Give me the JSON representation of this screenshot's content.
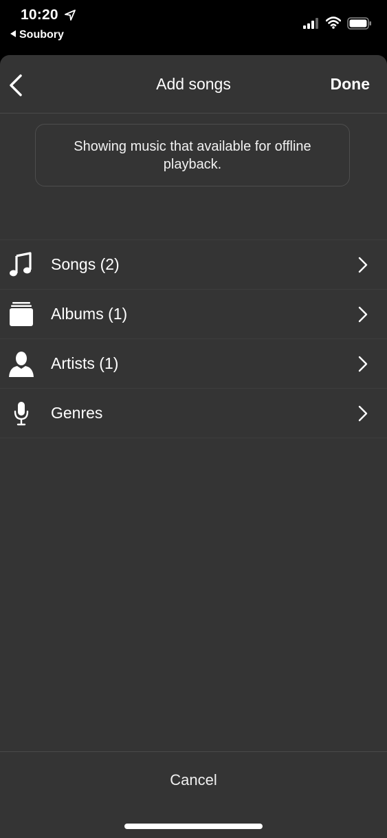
{
  "status_bar": {
    "time": "10:20",
    "back_app": "Soubory"
  },
  "nav": {
    "title": "Add songs",
    "done_label": "Done"
  },
  "notice": {
    "text": "Showing music that available for offline playback."
  },
  "categories": [
    {
      "icon": "music-note-icon",
      "label": "Songs (2)"
    },
    {
      "icon": "albums-stack-icon",
      "label": "Albums (1)"
    },
    {
      "icon": "person-icon",
      "label": "Artists (1)"
    },
    {
      "icon": "microphone-icon",
      "label": "Genres"
    }
  ],
  "footer": {
    "cancel_label": "Cancel"
  },
  "colors": {
    "sheet_bg": "#343434",
    "status_bg": "#000000",
    "text": "#ffffff"
  }
}
